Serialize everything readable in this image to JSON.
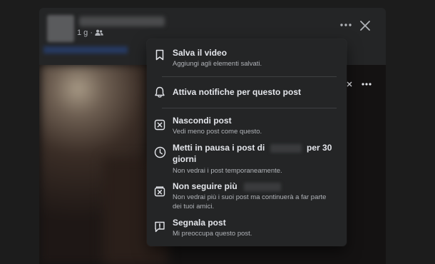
{
  "post": {
    "time_label": "1 g ·"
  },
  "menu": {
    "save": {
      "title": "Salva il video",
      "subtitle": "Aggiungi agli elementi salvati."
    },
    "notify": {
      "title": "Attiva notifiche per questo post"
    },
    "hide": {
      "title": "Nascondi post",
      "subtitle": "Vedi meno post come questo."
    },
    "pause": {
      "title_prefix": "Metti in pausa i post di",
      "title_suffix": "per 30",
      "title_line2": "giorni",
      "subtitle": "Non vedrai i post temporaneamente."
    },
    "unfollow": {
      "title": "Non seguire più",
      "subtitle_line1": "Non vedrai più i suoi post ma continuerà a far parte",
      "subtitle_line2": "dei tuoi amici."
    },
    "report": {
      "title": "Segnala post",
      "subtitle": "Mi preoccupa questo post."
    }
  }
}
